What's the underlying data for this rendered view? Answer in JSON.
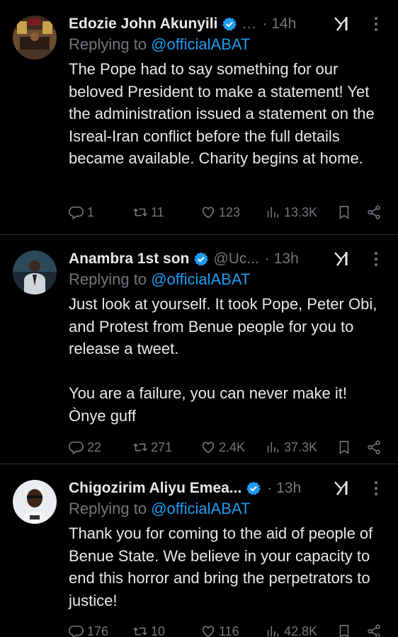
{
  "tweets": [
    {
      "name": "Edozie John Akunyili",
      "name_truncated": true,
      "handle": "…",
      "time": "· 14h",
      "replying_prefix": "Replying to ",
      "replying_to": "@officialABAT",
      "text": "The Pope had to say something for our beloved President to make a statement! Yet the administration issued a statement on the Isreal-Iran conflict before the full details became available. Charity begins at home.",
      "replies": "1",
      "retweets": "11",
      "likes": "123",
      "views": "13.3K"
    },
    {
      "name": "Anambra 1st son",
      "handle": "@Uc...",
      "time": "· 13h",
      "replying_prefix": "Replying to ",
      "replying_to": "@officialABAT",
      "text": "Just look at yourself. It took Pope, Peter Obi, and Protest from Benue people for you to release a tweet.\n\nYou are a failure, you can never make it! Ònye guff",
      "replies": "22",
      "retweets": "271",
      "likes": "2.4K",
      "views": "37.3K"
    },
    {
      "name": "Chigozirim Aliyu Emea...",
      "handle": "",
      "time": "· 13h",
      "replying_prefix": "Replying to ",
      "replying_to": "@officialABAT",
      "text": "Thank you for coming to the aid of people of Benue State. We believe in your capacity to end this horror and bring the perpetrators to justice!",
      "replies": "176",
      "retweets": "10",
      "likes": "116",
      "views": "42.8K"
    }
  ],
  "icons": {
    "verified": "verified-badge-icon",
    "grok": "grok-icon",
    "more": "more-options-icon",
    "reply": "reply-icon",
    "retweet": "retweet-icon",
    "like": "like-icon",
    "views": "views-icon",
    "bookmark": "bookmark-icon",
    "share": "share-icon"
  },
  "colors": {
    "background": "#000000",
    "text": "#e7e9ea",
    "muted": "#71767b",
    "accent": "#1d9bf0",
    "divider": "#2f3336"
  }
}
